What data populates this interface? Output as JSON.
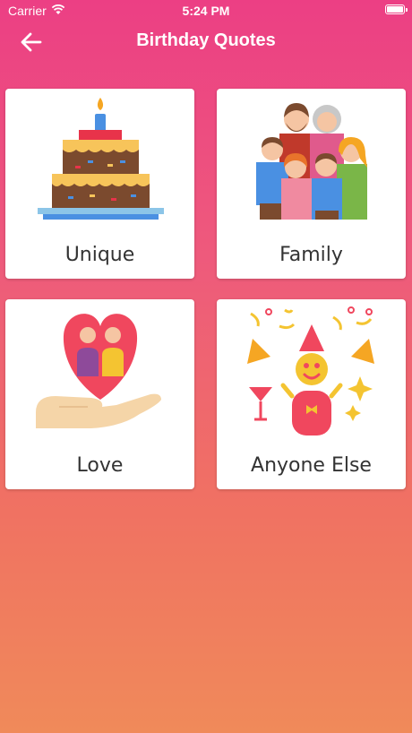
{
  "status": {
    "carrier": "Carrier",
    "time": "5:24 PM"
  },
  "nav": {
    "title": "Birthday Quotes"
  },
  "cards": [
    {
      "label": "Unique",
      "icon": "birthday-cake-icon"
    },
    {
      "label": "Family",
      "icon": "family-icon"
    },
    {
      "label": "Love",
      "icon": "heart-couple-hand-icon"
    },
    {
      "label": "Anyone Else",
      "icon": "party-icon"
    }
  ]
}
